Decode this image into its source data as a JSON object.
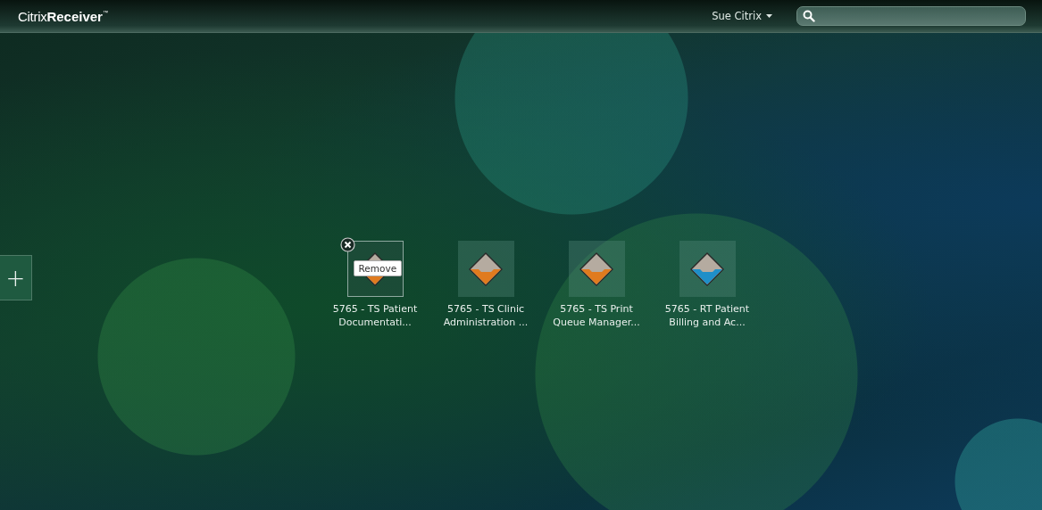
{
  "header": {
    "logo_light": "Citrix",
    "logo_bold": "Receiver",
    "logo_mark": "™",
    "user_menu": "Sue Citrix"
  },
  "add_button": "+",
  "apps": [
    {
      "name_line1": "5765 - TS Patient",
      "name_line2": "Documentati...",
      "color": "#e07b1f",
      "hovered": true,
      "tooltip": "Remove"
    },
    {
      "name_line1": "5765 - TS Clinic",
      "name_line2": "Administration ...",
      "color": "#e07b1f",
      "hovered": false
    },
    {
      "name_line1": "5765 - TS Print",
      "name_line2": "Queue Manager...",
      "color": "#e07b1f",
      "hovered": false
    },
    {
      "name_line1": "5765 - RT Patient",
      "name_line2": "Billing and Ac...",
      "color": "#1f8fc9",
      "hovered": false
    }
  ]
}
